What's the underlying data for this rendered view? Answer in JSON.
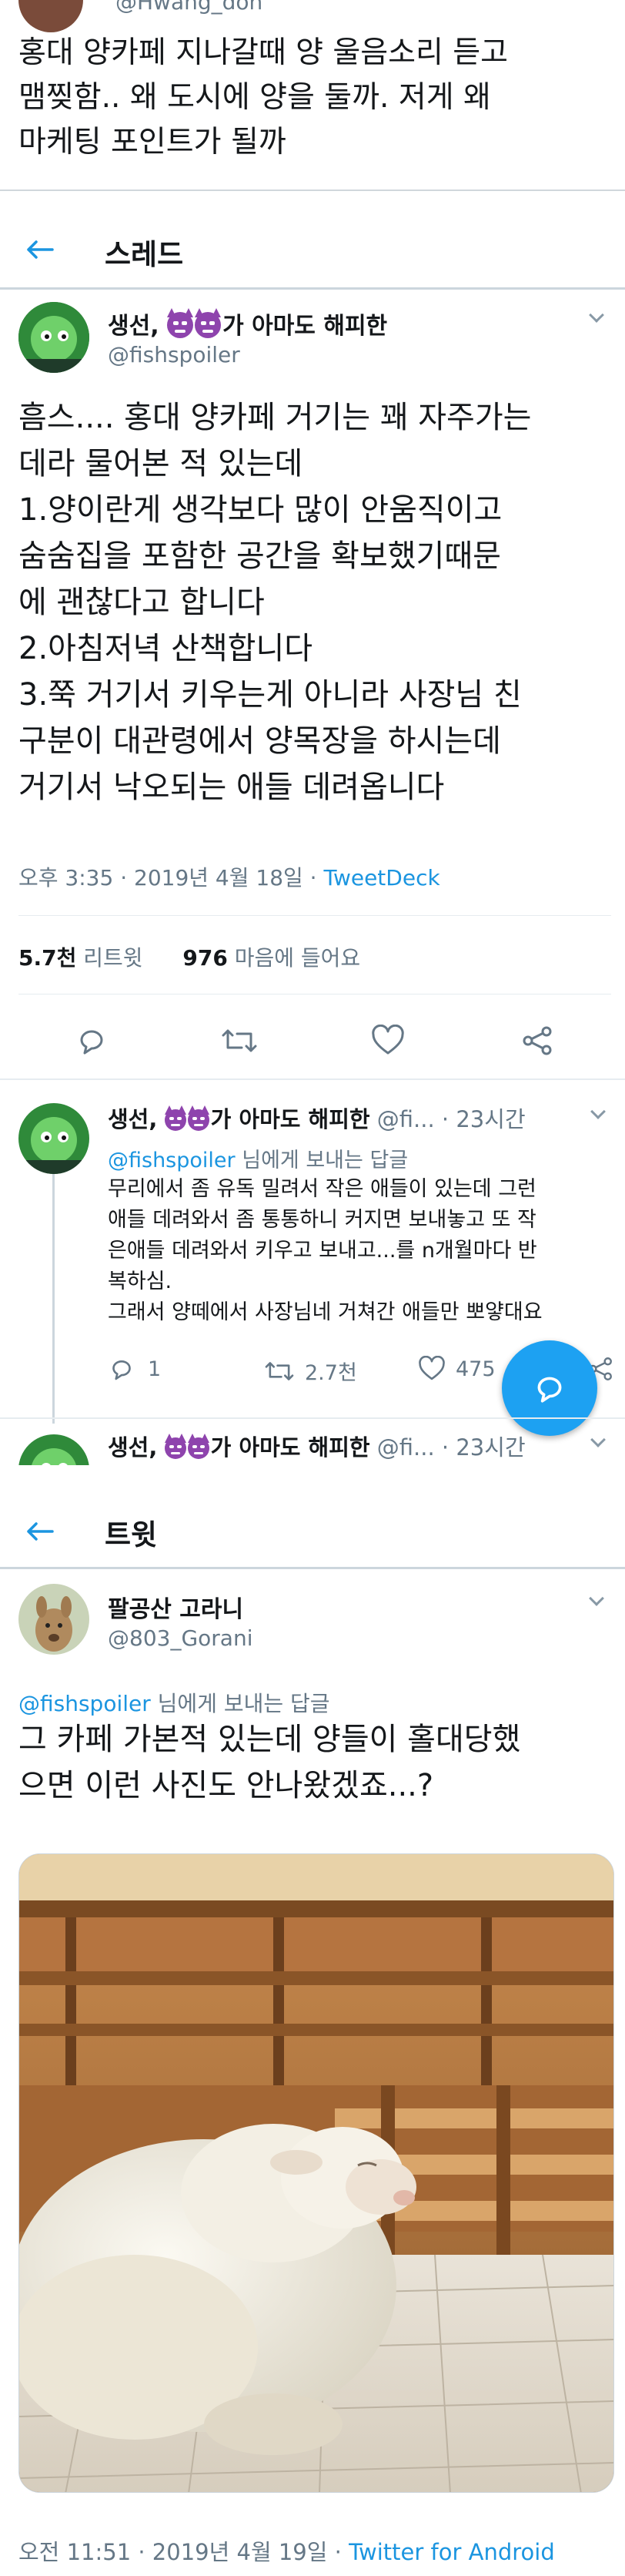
{
  "top": {
    "handle_partial": "@Hwang_don",
    "text": "홍대 양카페 지나갈때 양 울음소리 듣고\n맴찢함.. 왜 도시에 양을 둘까. 저게 왜\n마케팅 포인트가 될까"
  },
  "thread_header": {
    "title": "스레드"
  },
  "main_tweet": {
    "name": "생선,",
    "name_suffix": "가 아마도 해피한",
    "handle": "@fishspoiler",
    "text": "흠스.... 홍대 양카페 거기는 꽤 자주가는\n데라 물어본 적 있는데\n1.양이란게 생각보다 많이 안움직이고\n숨숨집을 포함한 공간을 확보했기때문\n에 괜찮다고 합니다\n2.아침저녁 산책합니다\n3.쭉 거기서 키우는게 아니라 사장님 친\n구분이 대관령에서 양목장을 하시는데\n거기서 낙오되는 애들 데려옵니다",
    "time_date": "오후 3:35 · 2019년 4월 18일 · ",
    "client": "TweetDeck",
    "retweets_count": "5.7천",
    "retweets_label": "리트윗",
    "likes_count": "976",
    "likes_label": "마음에 들어요"
  },
  "reply": {
    "name": "생선,",
    "name_suffix": "가 아마도 해피한",
    "handle": "@fi...",
    "time": "· 23시간",
    "replying_handle": "@fishspoiler",
    "replying_label": "님에게 보내는 답글",
    "text": "무리에서 좀 유독 밀려서 작은 애들이 있는데 그런\n애들 데려와서 좀 통통하니 커지면 보내놓고 또 작\n은애들 데려와서 키우고 보내고...를 n개월마다 반\n복하심.\n그래서 양떼에서 사장님네 거쳐간 애들만 뽀얗대요",
    "reply_count": "1",
    "retweet_count": "2.7천",
    "like_count": "475"
  },
  "reply2": {
    "name": "생선,",
    "name_suffix": "가 아마도 해피한",
    "handle": "@fi...",
    "time": "· 23시간"
  },
  "tweet_header": {
    "title": "트윗"
  },
  "second_tweet": {
    "name": "팔공산 고라니",
    "handle": "@803_Gorani",
    "replying_handle": "@fishspoiler",
    "replying_label": "님에게 보내는 답글",
    "text": "그 카페 가본적 있는데 양들이 홀대당했\n으면 이런 사진도 안나왔겠죠...?",
    "time_date": "오전 11:51 · 2019년 4월 19일 · ",
    "client": "Twitter for Android"
  },
  "colors": {
    "accent": "#1b95e0",
    "text": "#14171a",
    "muted": "#657786",
    "divider": "#e6ecf0"
  },
  "icons": [
    "back-arrow-icon",
    "chevron-down-icon",
    "reply-icon",
    "retweet-icon",
    "like-icon",
    "share-icon",
    "compose-reply-icon",
    "devil-emoji-icon"
  ]
}
